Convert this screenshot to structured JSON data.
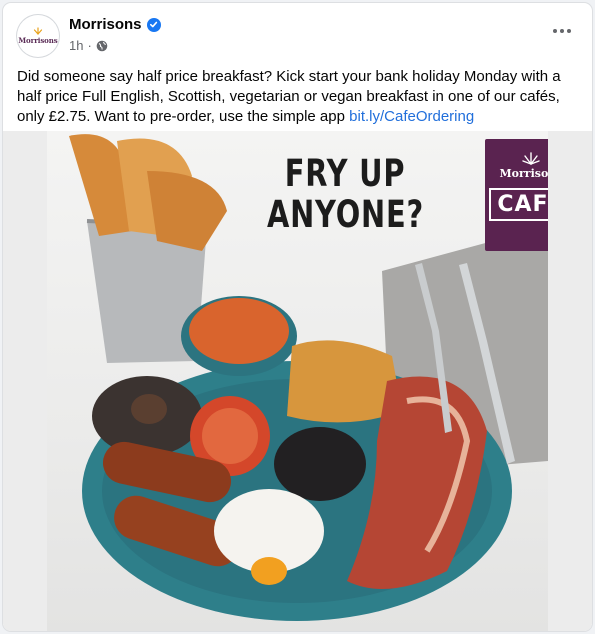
{
  "post": {
    "page_name": "Morrisons",
    "avatar_text": "Morrisons",
    "time": "1h",
    "separator": "·",
    "body_text": "Did someone say half price breakfast? Kick start your bank holiday Monday with a half price Full English, Scottish, vegetarian or vegan breakfast in one of our cafés, only £2.75. Want to pre-order, use the simple app ",
    "link_text": "bit.ly/CafeOrdering"
  },
  "image": {
    "headline_line1": "FRY UP",
    "headline_line2": "ANYONE?",
    "badge_brand": "Morrisons",
    "badge_cafe": "CAFÉ"
  },
  "icons": {
    "verified": "verified-badge-icon",
    "privacy": "globe-icon",
    "more": "more-options-icon"
  },
  "colors": {
    "brand_purple": "#5a2350",
    "link_blue": "#216fdb",
    "verified_blue": "#1877f2",
    "plate_teal": "#2e7f8a"
  }
}
